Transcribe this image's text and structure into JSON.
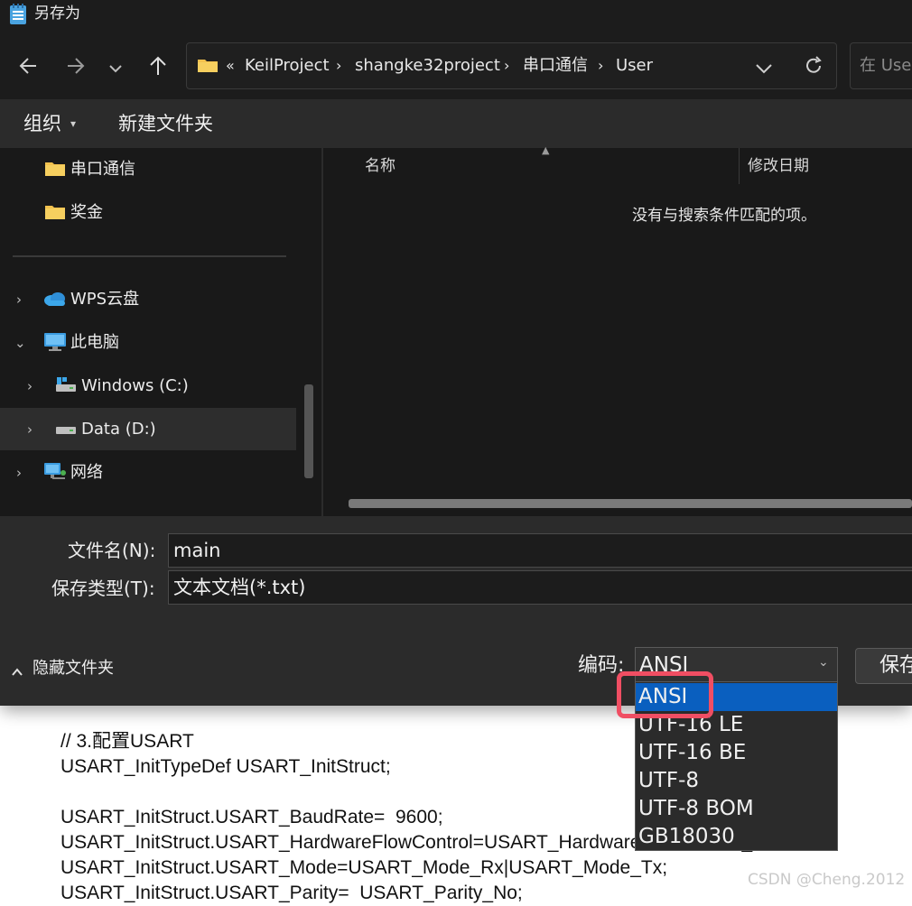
{
  "window": {
    "title": "另存为"
  },
  "address": {
    "overflow": "«",
    "crumbs": [
      "KeilProject",
      "shangke32project",
      "串口通信",
      "User"
    ]
  },
  "search": {
    "placeholder": "在 User"
  },
  "toolbar": {
    "organize_label": "组织",
    "new_folder_label": "新建文件夹"
  },
  "sidebar": {
    "items": [
      {
        "label": "串口通信",
        "icon": "folder-icon"
      },
      {
        "label": "奖金",
        "icon": "folder-icon"
      },
      {
        "label": "WPS云盘",
        "icon": "cloud-icon"
      },
      {
        "label": "此电脑",
        "icon": "computer-icon"
      },
      {
        "label": "Windows (C:)",
        "icon": "drive-icon"
      },
      {
        "label": "Data (D:)",
        "icon": "drive-icon"
      },
      {
        "label": "网络",
        "icon": "network-icon"
      }
    ]
  },
  "filelist": {
    "columns": [
      "名称",
      "修改日期"
    ],
    "empty_message": "没有与搜索条件匹配的项。"
  },
  "form": {
    "filename_label": "文件名(N):",
    "filename_value": "main",
    "filetype_label": "保存类型(T):",
    "filetype_value": "文本文档(*.txt)",
    "encoding_label": "编码:",
    "encoding_value": "ANSI",
    "hide_folders_label": "隐藏文件夹",
    "save_label": "保存"
  },
  "encoding_options": [
    "ANSI",
    "UTF-16 LE",
    "UTF-16 BE",
    "UTF-8",
    "UTF-8 BOM",
    "GB18030"
  ],
  "background_code": [
    "// 3.配置USART",
    "USART_InitTypeDef USART_InitStruct;",
    "",
    "USART_InitStruct.USART_BaudRate=  9600;",
    "USART_InitStruct.USART_HardwareFlowControl=USART_HardwareFlowControl_None;",
    "USART_InitStruct.USART_Mode=USART_Mode_Rx|USART_Mode_Tx;",
    "USART_InitStruct.USART_Parity=  USART_Parity_No;"
  ],
  "watermark": "CSDN @Cheng.2012",
  "colors": {
    "selection": "#0a5fbf",
    "highlight_box": "#f04e63",
    "dialog_bg": "#202020"
  }
}
